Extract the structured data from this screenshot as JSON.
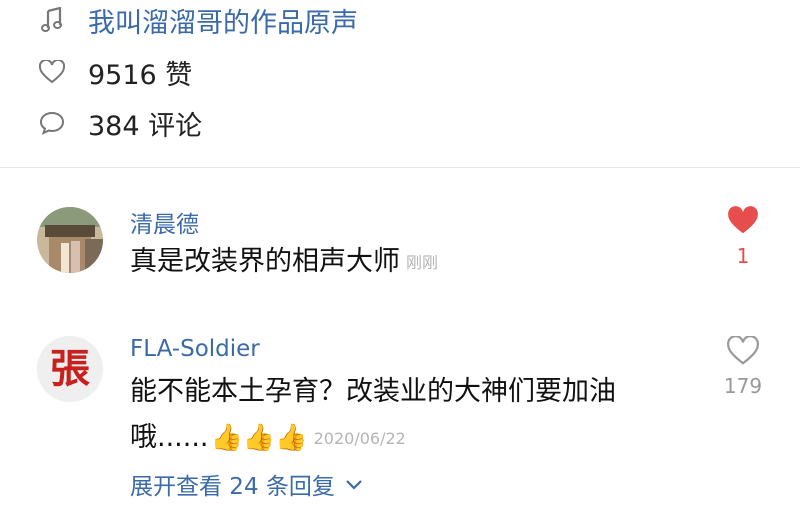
{
  "post": {
    "music_title": "我叫溜溜哥的作品原声",
    "likes": "9516 赞",
    "comments": "384 评论"
  },
  "comments": [
    {
      "username": "清晨德",
      "text": "真是改装界的相声大师",
      "time": "刚刚",
      "like_count": "1",
      "liked": true
    },
    {
      "username": "FLA-Soldier",
      "text_line1": "能不能本土孕育？改装业的大神们要加油",
      "text_line2": "哦......",
      "emoji": "👍👍👍",
      "time": "2020/06/22",
      "like_count": "179",
      "liked": false,
      "avatar_char": "張"
    }
  ],
  "replies_label": "展开查看 24 条回复",
  "colors": {
    "link": "#3b6aa8",
    "like_red": "#e84d4d",
    "timestamp": "#b5b5b5"
  }
}
